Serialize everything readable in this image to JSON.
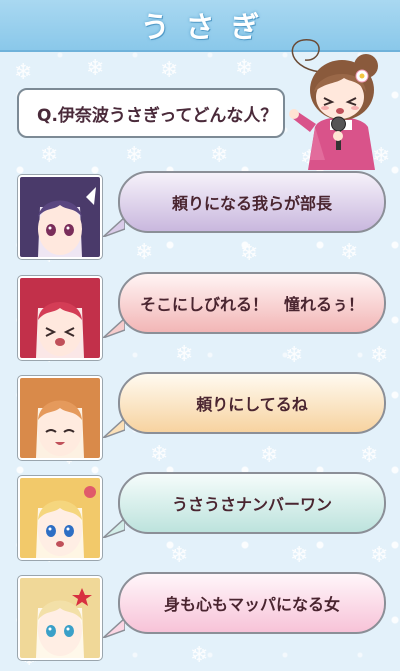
{
  "header": {
    "title": "うさぎ"
  },
  "question": {
    "text": "Q.伊奈波うさぎってどんな人？"
  },
  "answers": [
    {
      "text": "頼りになる我らが部長",
      "color": "#c9b8de"
    },
    {
      "text": "そこにしびれる！　憧れるぅ！",
      "color": "#f2b6b6"
    },
    {
      "text": "頼りにしてるね",
      "color": "#f7d3a0"
    },
    {
      "text": "うさうさナンバーワン",
      "color": "#bde3dd"
    },
    {
      "text": "身も心もマッパになる女",
      "color": "#f7c3d8"
    }
  ]
}
